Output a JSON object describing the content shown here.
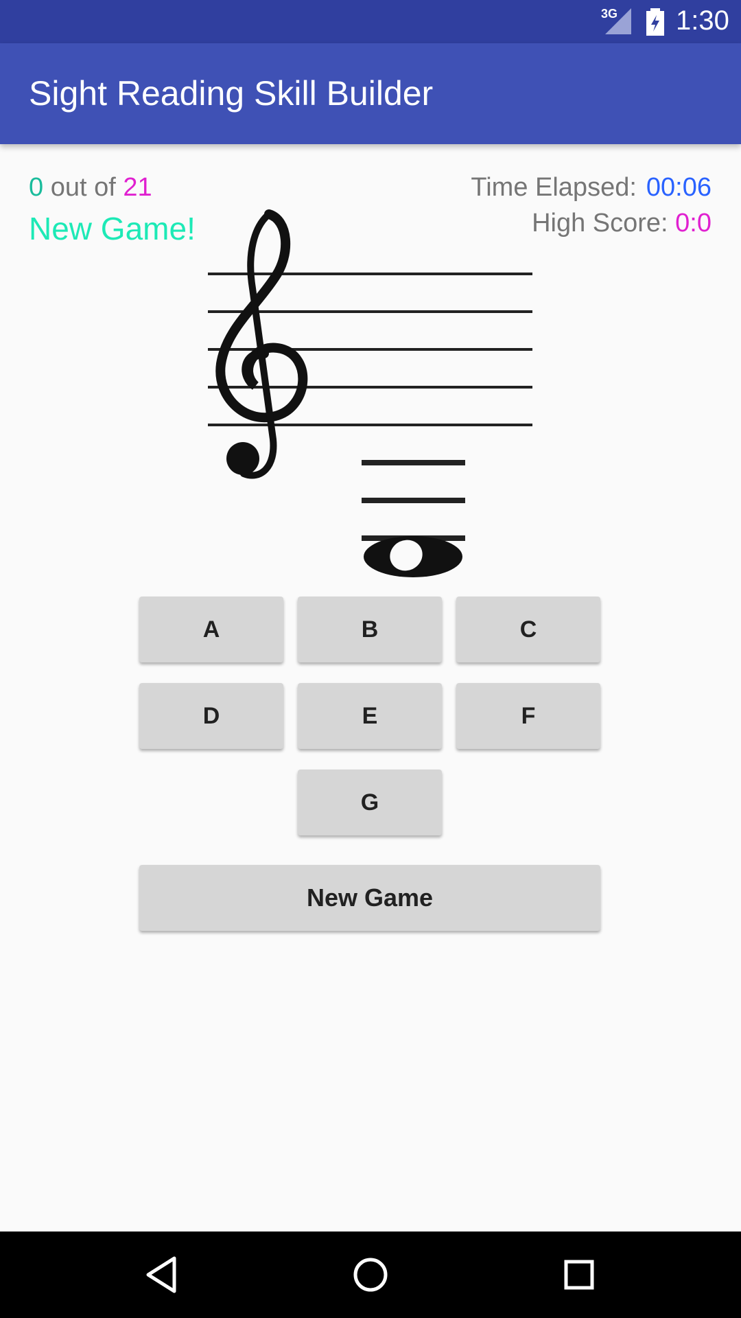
{
  "status_bar": {
    "network": "3G",
    "time": "1:30",
    "icons": [
      "signal-icon",
      "battery-icon"
    ]
  },
  "app_bar": {
    "title": "Sight Reading Skill Builder"
  },
  "score": {
    "correct": "0",
    "separator": "out of",
    "total": "21"
  },
  "message": "New Game!",
  "timer": {
    "label": "Time Elapsed:",
    "value": "00:06"
  },
  "high_score": {
    "label": "High Score:",
    "value": "0:0"
  },
  "staff": {
    "clef": "treble-clef-icon",
    "note": "whole-note-icon"
  },
  "answer_buttons": {
    "a": "A",
    "b": "B",
    "c": "C",
    "d": "D",
    "e": "E",
    "f": "F",
    "g": "G"
  },
  "new_game_button": "New Game",
  "nav_bar": {
    "icons": [
      "back-icon",
      "home-icon",
      "recents-icon"
    ]
  },
  "colors": {
    "status_bar": "#303f9f",
    "app_bar": "#3f51b5",
    "correct": "#1abc9c",
    "total": "#e020d0",
    "message": "#1de9b6",
    "timer": "#2962ff",
    "button": "#d6d6d6"
  }
}
